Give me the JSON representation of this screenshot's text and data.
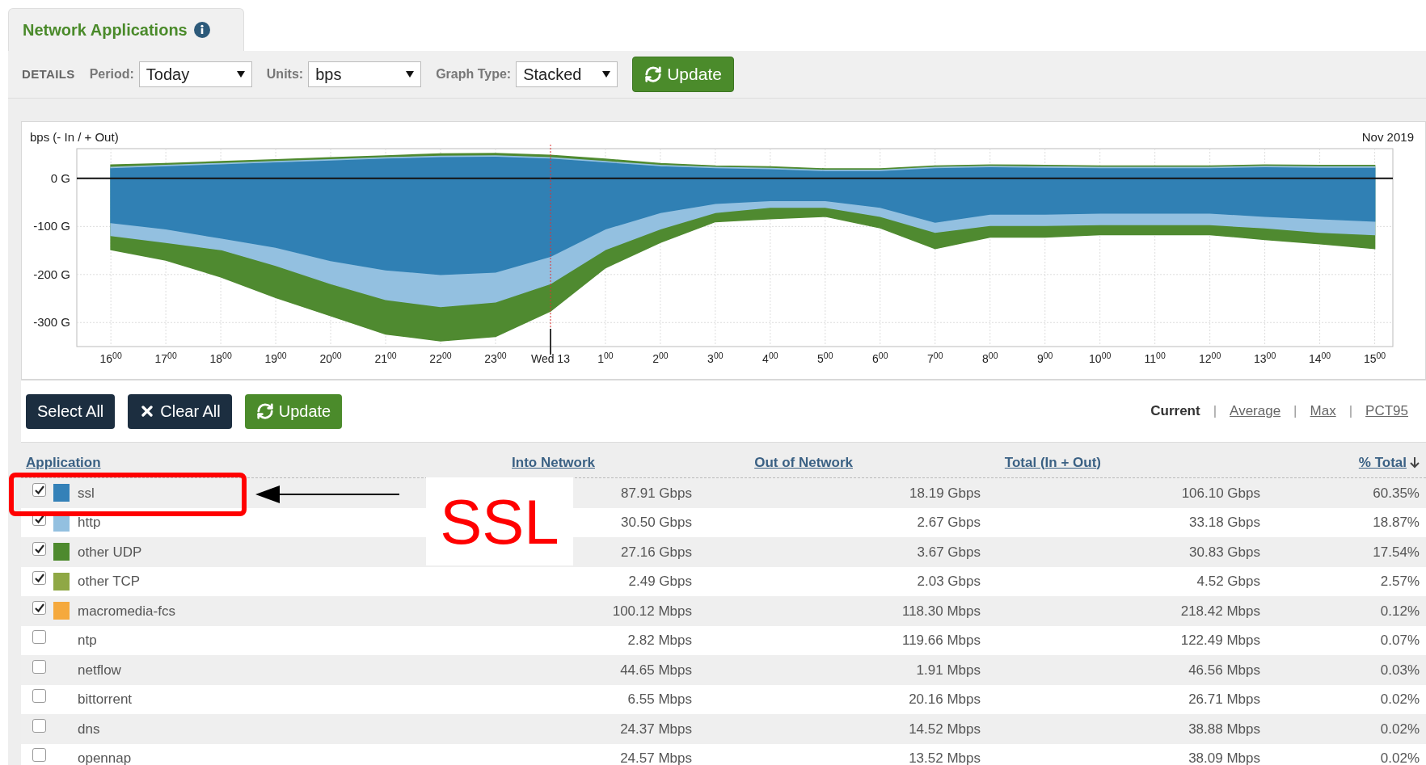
{
  "tab": {
    "title": "Network Applications"
  },
  "toolbar": {
    "section": "DETAILS",
    "fields": [
      {
        "label": "Period:",
        "value": "Today"
      },
      {
        "label": "Units:",
        "value": "bps"
      },
      {
        "label": "Graph Type:",
        "value": "Stacked"
      }
    ],
    "update_button": "Update"
  },
  "chart": {
    "unit_label": "bps (- In / + Out)",
    "date_label": "Nov 2019",
    "chart_data": {
      "type": "area",
      "stacked": false,
      "grid": true,
      "ylim": [
        -350,
        62
      ],
      "categories": [
        "16$^{00}$",
        "17$^{00}$",
        "18$^{00}$",
        "19$^{00}$",
        "20$^{00}$",
        "21$^{00}$",
        "22$^{00}$",
        "23$^{00}$",
        "Wed 13",
        "1$^{00}$",
        "2$^{00}$",
        "3$^{00}$",
        "4$^{00}$",
        "5$^{00}$",
        "6$^{00}$",
        "7$^{00}$",
        "8$^{00}$",
        "9$^{00}$",
        "10$^{00}$",
        "11$^{00}$",
        "12$^{00}$",
        "13$^{00}$",
        "14$^{00}$",
        "15$^{00}$"
      ],
      "series": [
        {
          "color": "#4f8a30",
          "values": [
            -148,
            -170,
            -205,
            -248,
            -286,
            -324,
            -338,
            -329,
            -276,
            -186,
            -133,
            -90,
            -84,
            -79,
            -103,
            -146,
            -122,
            -122,
            -117,
            -117,
            -117,
            -127,
            -136,
            -146
          ]
        },
        {
          "color": "#93c0e0",
          "values": [
            -119,
            -133,
            -148,
            -181,
            -219,
            -252,
            -267,
            -257,
            -219,
            -148,
            -105,
            -71,
            -60,
            -60,
            -79,
            -112,
            -98,
            -98,
            -96,
            -96,
            -96,
            -103,
            -112,
            -117
          ]
        },
        {
          "color": "#3080b4",
          "values": [
            -92,
            -105,
            -124,
            -143,
            -171,
            -190,
            -200,
            -195,
            -162,
            -105,
            -71,
            -52,
            -46,
            -46,
            -60,
            -91,
            -74,
            -74,
            -72,
            -72,
            -72,
            -79,
            -84,
            -89
          ]
        },
        {
          "color": "#4f8a30",
          "values": [
            28,
            31,
            35,
            39,
            43,
            47,
            51,
            52,
            48,
            40,
            31,
            26,
            24,
            20,
            20,
            26,
            28,
            27,
            26,
            26,
            26,
            28,
            27,
            27
          ]
        },
        {
          "color": "#93c0e0",
          "values": [
            23,
            27,
            31,
            35,
            39,
            43,
            46,
            47,
            43,
            35,
            27,
            23,
            21,
            17,
            17,
            23,
            25,
            24,
            23,
            23,
            23,
            25,
            24,
            24
          ]
        },
        {
          "color": "#3080b4",
          "values": [
            20,
            24,
            28,
            32,
            36,
            40,
            43,
            44,
            40,
            32,
            24,
            20,
            18,
            14,
            14,
            20,
            22,
            21,
            20,
            20,
            20,
            22,
            21,
            21
          ]
        }
      ],
      "yticks": [
        {
          "value": 0,
          "label": "0 G"
        },
        {
          "value": -100,
          "label": "-100 G"
        },
        {
          "value": -200,
          "label": "-200 G"
        },
        {
          "value": -300,
          "label": "-300 G"
        }
      ]
    }
  },
  "actions": {
    "select_all": "Select All",
    "clear_all": "Clear All",
    "update": "Update"
  },
  "stat_modes": {
    "separator": "|",
    "items": [
      {
        "label": "Current",
        "selected": true
      },
      {
        "label": "Average",
        "selected": false
      },
      {
        "label": "Max",
        "selected": false
      },
      {
        "label": "PCT95",
        "selected": false
      }
    ]
  },
  "table": {
    "columns": [
      {
        "label": "Application",
        "sorted": false
      },
      {
        "label": "Into Network",
        "sorted": false
      },
      {
        "label": "Out of Network",
        "sorted": false
      },
      {
        "label": "Total (In + Out)",
        "sorted": false
      },
      {
        "label": "% Total",
        "sorted": true
      }
    ],
    "rows": [
      {
        "checked": true,
        "color": "#3481b8",
        "name": "ssl",
        "in": "87.91 Gbps",
        "out": "18.19 Gbps",
        "total": "106.10 Gbps",
        "pct": "60.35%"
      },
      {
        "checked": true,
        "color": "#93c0e0",
        "name": "http",
        "in": "30.50 Gbps",
        "out": "2.67 Gbps",
        "total": "33.18 Gbps",
        "pct": "18.87%"
      },
      {
        "checked": true,
        "color": "#4e8a2e",
        "name": "other UDP",
        "in": "27.16 Gbps",
        "out": "3.67 Gbps",
        "total": "30.83 Gbps",
        "pct": "17.54%"
      },
      {
        "checked": true,
        "color": "#8fa845",
        "name": "other TCP",
        "in": "2.49 Gbps",
        "out": "2.03 Gbps",
        "total": "4.52 Gbps",
        "pct": "2.57%"
      },
      {
        "checked": true,
        "color": "#f5a93d",
        "name": "macromedia-fcs",
        "in": "100.12 Mbps",
        "out": "118.30 Mbps",
        "total": "218.42 Mbps",
        "pct": "0.12%"
      },
      {
        "checked": false,
        "name": "ntp",
        "in": "2.82 Mbps",
        "out": "119.66 Mbps",
        "total": "122.49 Mbps",
        "pct": "0.07%"
      },
      {
        "checked": false,
        "name": "netflow",
        "in": "44.65 Mbps",
        "out": "1.91 Mbps",
        "total": "46.56 Mbps",
        "pct": "0.03%"
      },
      {
        "checked": false,
        "name": "bittorrent",
        "in": "6.55 Mbps",
        "out": "20.16 Mbps",
        "total": "26.71 Mbps",
        "pct": "0.02%"
      },
      {
        "checked": false,
        "name": "dns",
        "in": "24.37 Mbps",
        "out": "14.52 Mbps",
        "total": "38.88 Mbps",
        "pct": "0.02%"
      },
      {
        "checked": false,
        "name": "opennap",
        "in": "24.57 Mbps",
        "out": "13.52 Mbps",
        "total": "38.09 Mbps",
        "pct": "0.02%"
      }
    ]
  },
  "callout": {
    "text": "SSL"
  }
}
